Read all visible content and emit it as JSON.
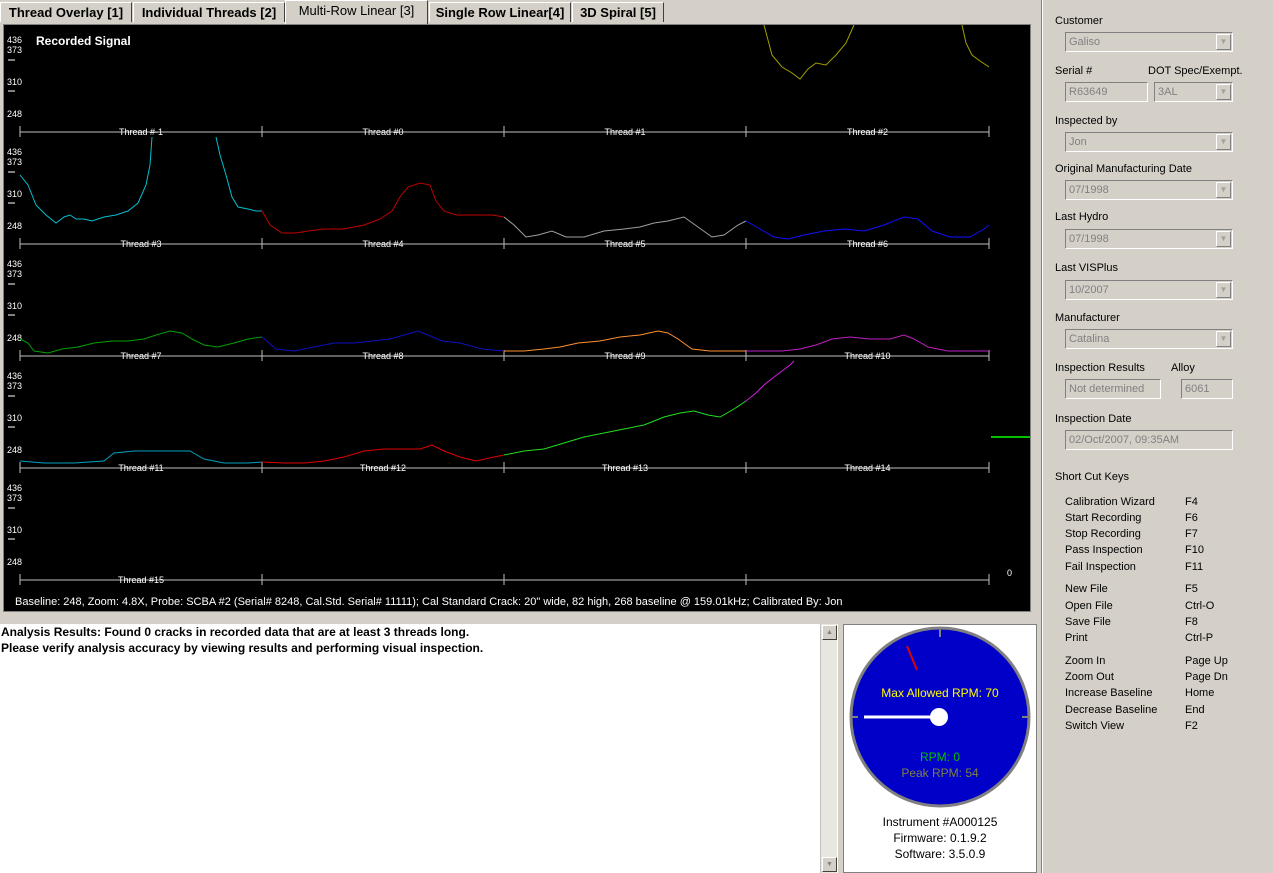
{
  "tabs": [
    {
      "label": "Thread Overlay [1]",
      "active": false
    },
    {
      "label": "Individual Threads [2]",
      "active": false
    },
    {
      "label": "Multi-Row Linear [3]",
      "active": true
    },
    {
      "label": "Single Row Linear[4]",
      "active": false
    },
    {
      "label": "3D Spiral [5]",
      "active": false
    }
  ],
  "plot": {
    "title": "Recorded Signal",
    "y_ticks": [
      "436",
      "373",
      "310",
      "248"
    ],
    "rows": [
      [
        "Thread #-1",
        "Thread #0",
        "Thread #1",
        "Thread #2"
      ],
      [
        "Thread #3",
        "Thread #4",
        "Thread #5",
        "Thread #6"
      ],
      [
        "Thread #7",
        "Thread #8",
        "Thread #9",
        "Thread #10"
      ],
      [
        "Thread #11",
        "Thread #12",
        "Thread #13",
        "Thread #14"
      ],
      [
        "Thread #15",
        "",
        "",
        ""
      ]
    ],
    "marker_value": "0",
    "status": "Baseline: 248, Zoom: 4.8X, Probe: SCBA #2 (Serial# 8248, Cal.Std. Serial# 11111); Cal Standard Crack: 20\" wide, 82 high, 268 baseline @ 159.01kHz; Calibrated By: Jon",
    "colors": {
      "thread_0_2": "#a0a000",
      "thread_3": "#00c0d0",
      "thread_4": "#c00000",
      "thread_5": "#a0a0a0",
      "thread_6": "#1010ff",
      "thread_7": "#00a000",
      "thread_8": "#1010c0",
      "thread_9": "#ff9030",
      "thread_10": "#c020c0",
      "thread_11": "#00a0c0",
      "thread_12": "#e00000",
      "thread_13": "#20e020",
      "thread_14": "#d020e0",
      "marker": "#00c000"
    }
  },
  "analysis": {
    "line1": "Analysis Results: Found 0 cracks in recorded data that are at least 3 threads long.",
    "line2": "Please verify analysis accuracy by viewing results and performing visual inspection."
  },
  "gauge": {
    "max_label": "Max Allowed RPM: 70",
    "rpm_label": "RPM: 0",
    "peak_label": "Peak RPM: 54",
    "rpm": 0,
    "max_rpm": 70,
    "peak_rpm": 54,
    "instrument": "Instrument #A000125",
    "firmware": "Firmware: 0.1.9.2",
    "software": "Software: 3.5.0.9",
    "colors": {
      "face": "#0000c8",
      "rim": "#808080",
      "needle": "#ffffff",
      "max_needle": "#e00000",
      "rpm_text": "#00c000",
      "peak_text": "#808040",
      "max_text": "#ffff00"
    }
  },
  "form": {
    "customer_label": "Customer",
    "customer": "Galiso",
    "serial_label": "Serial #",
    "serial": "R63649",
    "dot_label": "DOT Spec/Exempt.",
    "dot": "3AL",
    "inspected_label": "Inspected by",
    "inspected": "Jon",
    "omd_label": "Original Manufacturing Date",
    "omd": "07/1998",
    "hydro_label": "Last Hydro",
    "hydro": "07/1998",
    "vis_label": "Last VISPlus",
    "vis": "10/2007",
    "manuf_label": "Manufacturer",
    "manuf": "Catalina",
    "results_label": "Inspection Results",
    "results": "Not determined",
    "alloy_label": "Alloy",
    "alloy": "6061",
    "idate_label": "Inspection Date",
    "idate": "02/Oct/2007, 09:35AM"
  },
  "shortcuts": {
    "title": "Short Cut Keys",
    "items": [
      [
        "Calibration Wizard",
        "F4"
      ],
      [
        "Start Recording",
        "F6"
      ],
      [
        "Stop Recording",
        "F7"
      ],
      [
        "Pass Inspection",
        "F10"
      ],
      [
        "Fail Inspection",
        "F11"
      ],
      [
        "New File",
        "F5"
      ],
      [
        "Open File",
        "Ctrl-O"
      ],
      [
        "Save File",
        "F8"
      ],
      [
        "Print",
        "Ctrl-P"
      ],
      [
        "Zoom In",
        "Page Up"
      ],
      [
        "Zoom Out",
        "Page Dn"
      ],
      [
        "Increase Baseline",
        "Home"
      ],
      [
        "Decrease Baseline",
        "End"
      ],
      [
        "Switch View",
        "F2"
      ]
    ]
  }
}
